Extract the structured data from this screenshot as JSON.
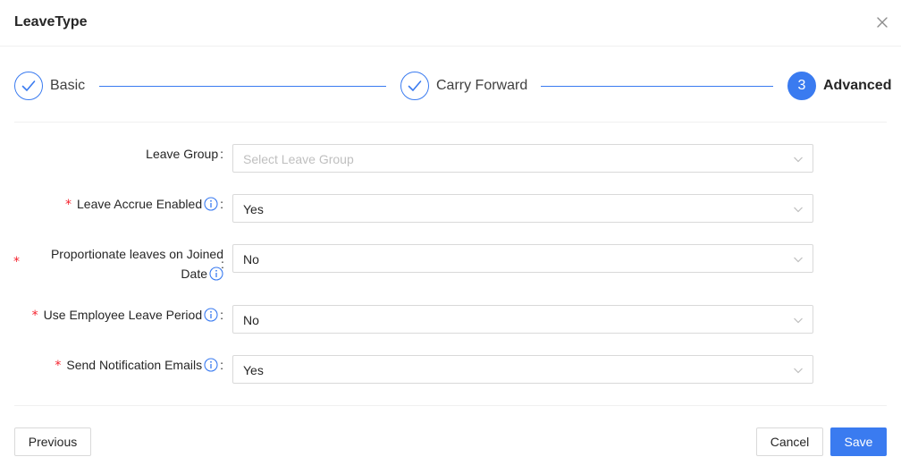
{
  "modal": {
    "title": "LeaveType"
  },
  "steps": [
    {
      "title": "Basic",
      "status": "finished"
    },
    {
      "title": "Carry Forward",
      "status": "finished"
    },
    {
      "title": "Advanced",
      "status": "active",
      "number": "3"
    }
  ],
  "form": {
    "leave_group": {
      "label": "Leave Group",
      "placeholder": "Select Leave Group",
      "value": ""
    },
    "leave_accrue_enabled": {
      "label": "Leave Accrue Enabled",
      "value": "Yes",
      "required": true
    },
    "proportionate_leaves": {
      "label_line1": "Proportionate leaves on Joined",
      "label_line2": "Date",
      "value": "No",
      "required": true
    },
    "use_employee_leave_period": {
      "label": "Use Employee Leave Period",
      "value": "No",
      "required": true
    },
    "send_notification_emails": {
      "label": "Send Notification Emails",
      "value": "Yes",
      "required": true
    },
    "colon": ":",
    "required_mark": "*"
  },
  "footer": {
    "previous_label": "Previous",
    "cancel_label": "Cancel",
    "save_label": "Save"
  },
  "colors": {
    "accent": "#3a7bf0",
    "required": "#f5222d",
    "border": "#d9d9d9"
  }
}
